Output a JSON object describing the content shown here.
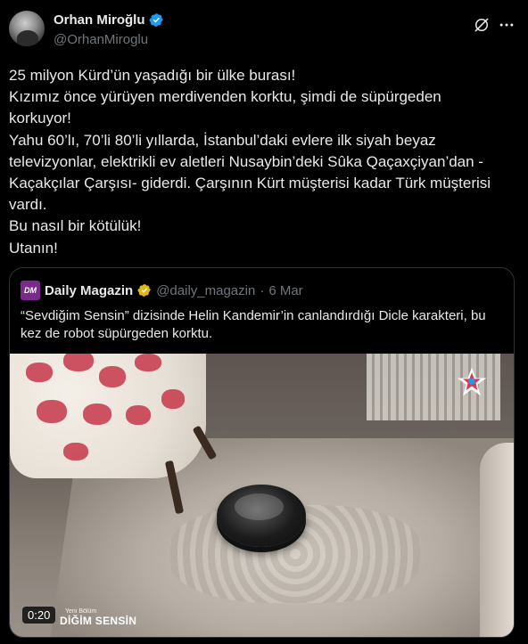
{
  "author": {
    "name": "Orhan Miroğlu",
    "handle": "@OrhanMiroglu",
    "verified_color": "#1d9bf0"
  },
  "icons": {
    "avatar": "user-photo",
    "verified": "verified-badge-icon",
    "grok": "grok-icon",
    "more": "more-icon"
  },
  "tweet": {
    "lines": [
      "25 milyon Kürd’ün yaşadığı bir ülke burası!",
      "Kızımız önce yürüyen merdivenden korktu, şimdi de süpürgeden",
      "korkuyor!",
      "Yahu 60’lı, 70’li 80’li yıllarda, İstanbul’daki evlere ilk siyah beyaz",
      "televizyonlar, elektrikli ev aletleri Nusaybin’deki Sûka Qaçaxçiyan’dan -",
      "Kaçakçılar Çarşısı- giderdi. Çarşının Kürt müşterisi kadar Türk müşterisi",
      "vardı.",
      "Bu nasıl bir kötülük!",
      "Utanın!"
    ]
  },
  "quote": {
    "logo_text": "DM",
    "name": "Daily Magazin",
    "handle": "@daily_magazin",
    "separator": "·",
    "date": "6 Mar",
    "badge_color": "#e2b719",
    "text": "“Sevdiğim Sensin” dizisinde Helin Kandemir’in canlandırdığı Dicle karakteri, bu kez de robot süpürgeden korktu.",
    "video": {
      "duration": "0:20",
      "caption_small": "Yeni Bölüm",
      "caption_big": "DİĞİM SENSİN"
    }
  }
}
